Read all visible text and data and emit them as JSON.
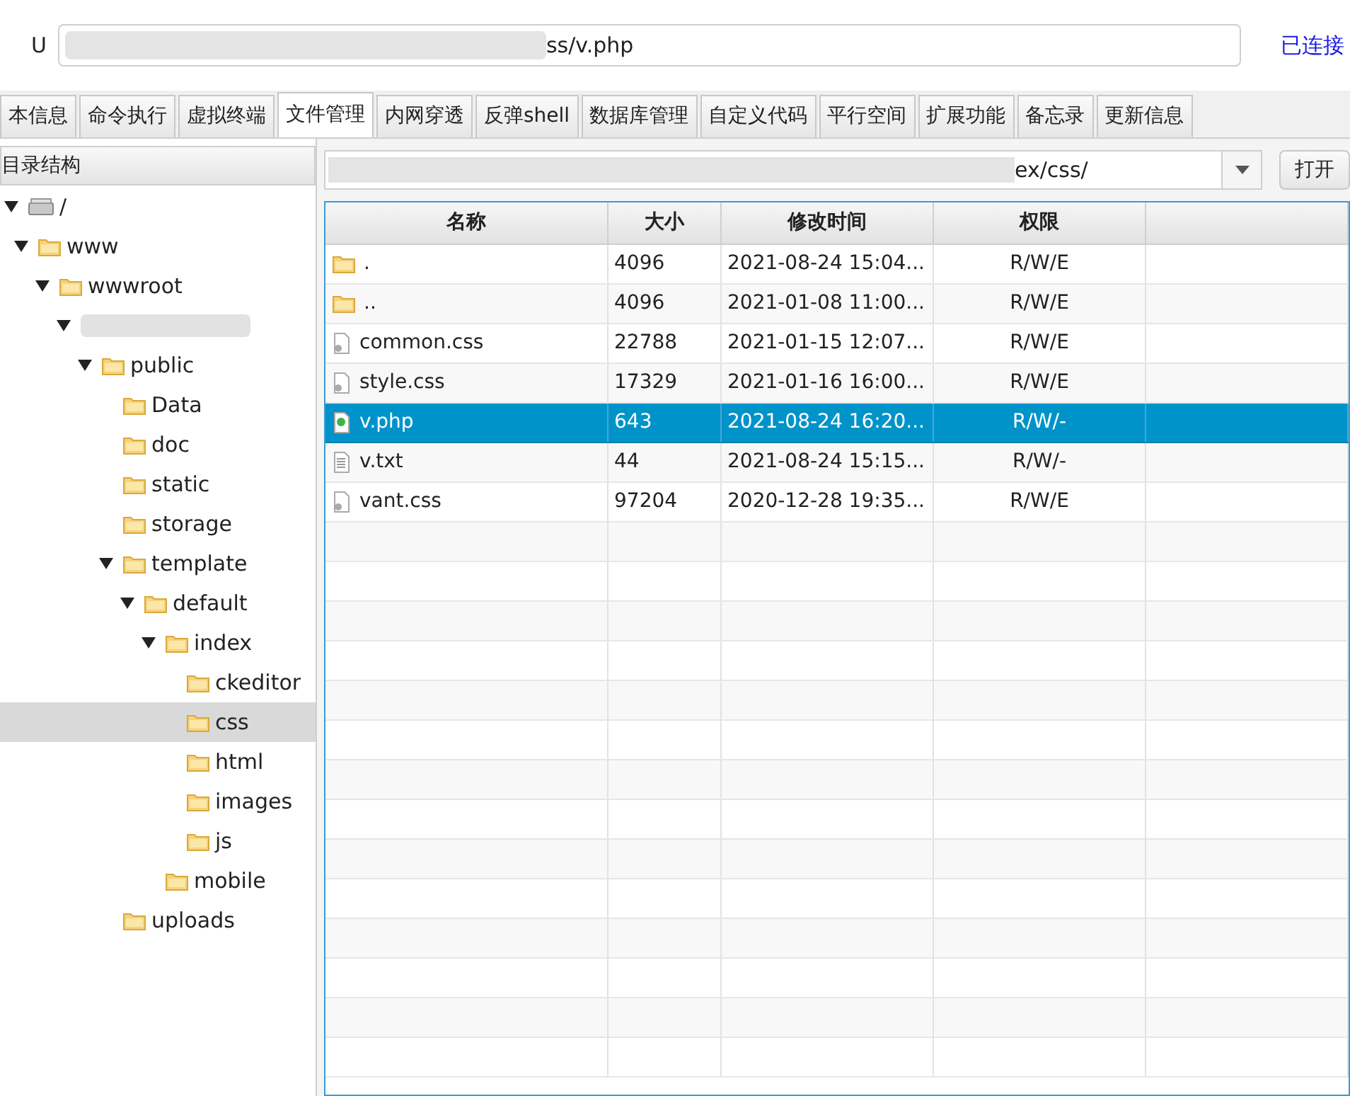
{
  "url_bar": {
    "label": "U",
    "value": "ss/v.php",
    "status": "已连接"
  },
  "tabs": [
    {
      "label": "本信息",
      "selected": false
    },
    {
      "label": "命令执行",
      "selected": false
    },
    {
      "label": "虚拟终端",
      "selected": false
    },
    {
      "label": "文件管理",
      "selected": true
    },
    {
      "label": "内网穿透",
      "selected": false
    },
    {
      "label": "反弹shell",
      "selected": false
    },
    {
      "label": "数据库管理",
      "selected": false
    },
    {
      "label": "自定义代码",
      "selected": false
    },
    {
      "label": "平行空间",
      "selected": false
    },
    {
      "label": "扩展功能",
      "selected": false
    },
    {
      "label": "备忘录",
      "selected": false
    },
    {
      "label": "更新信息",
      "selected": false
    }
  ],
  "tree": {
    "title": "目录结构",
    "items": [
      {
        "label": "/",
        "kind": "drive",
        "expanded": true,
        "selected": false,
        "children": [
          {
            "label": "www",
            "kind": "folder",
            "expanded": true,
            "selected": false,
            "children": [
              {
                "label": "wwwroot",
                "kind": "folder",
                "expanded": true,
                "selected": false,
                "children": [
                  {
                    "kind": "redacted",
                    "expanded": true,
                    "selected": false,
                    "children": [
                      {
                        "label": "public",
                        "kind": "folder",
                        "expanded": true,
                        "selected": false,
                        "children": [
                          {
                            "label": "Data",
                            "kind": "folder",
                            "selected": false
                          },
                          {
                            "label": "doc",
                            "kind": "folder",
                            "selected": false
                          },
                          {
                            "label": "static",
                            "kind": "folder",
                            "selected": false
                          },
                          {
                            "label": "storage",
                            "kind": "folder",
                            "selected": false
                          },
                          {
                            "label": "template",
                            "kind": "folder",
                            "expanded": true,
                            "selected": false,
                            "children": [
                              {
                                "label": "default",
                                "kind": "folder",
                                "expanded": true,
                                "selected": false,
                                "children": [
                                  {
                                    "label": "index",
                                    "kind": "folder",
                                    "expanded": true,
                                    "selected": false,
                                    "children": [
                                      {
                                        "label": "ckeditor",
                                        "kind": "folder",
                                        "selected": false
                                      },
                                      {
                                        "label": "css",
                                        "kind": "folder",
                                        "selected": true
                                      },
                                      {
                                        "label": "html",
                                        "kind": "folder",
                                        "selected": false
                                      },
                                      {
                                        "label": "images",
                                        "kind": "folder",
                                        "selected": false
                                      },
                                      {
                                        "label": "js",
                                        "kind": "folder",
                                        "selected": false
                                      }
                                    ]
                                  },
                                  {
                                    "label": "mobile",
                                    "kind": "folder",
                                    "selected": false
                                  }
                                ]
                              }
                            ]
                          },
                          {
                            "label": "uploads",
                            "kind": "folder",
                            "selected": false
                          }
                        ]
                      }
                    ]
                  }
                ]
              }
            ]
          }
        ]
      }
    ]
  },
  "path_bar": {
    "value": "ex/css/",
    "button": "打开"
  },
  "table": {
    "columns": [
      "名称",
      "大小",
      "修改时间",
      "权限"
    ],
    "rows": [
      {
        "kind": "folder",
        "name": ".",
        "size": "4096",
        "modified": "2021-08-24 15:04...",
        "permissions": "R/W/E",
        "selected": false
      },
      {
        "kind": "folder",
        "name": "..",
        "size": "4096",
        "modified": "2021-01-08 11:00...",
        "permissions": "R/W/E",
        "selected": false
      },
      {
        "kind": "script",
        "name": "common.css",
        "size": "22788",
        "modified": "2021-01-15 12:07...",
        "permissions": "R/W/E",
        "selected": false
      },
      {
        "kind": "script",
        "name": "style.css",
        "size": "17329",
        "modified": "2021-01-16 16:00...",
        "permissions": "R/W/E",
        "selected": false
      },
      {
        "kind": "php",
        "name": "v.php",
        "size": "643",
        "modified": "2021-08-24 16:20...",
        "permissions": "R/W/-",
        "selected": true
      },
      {
        "kind": "text",
        "name": "v.txt",
        "size": "44",
        "modified": "2021-08-24 15:15...",
        "permissions": "R/W/-",
        "selected": false
      },
      {
        "kind": "script",
        "name": "vant.css",
        "size": "97204",
        "modified": "2020-12-28 19:35...",
        "permissions": "R/W/E",
        "selected": false
      }
    ]
  }
}
